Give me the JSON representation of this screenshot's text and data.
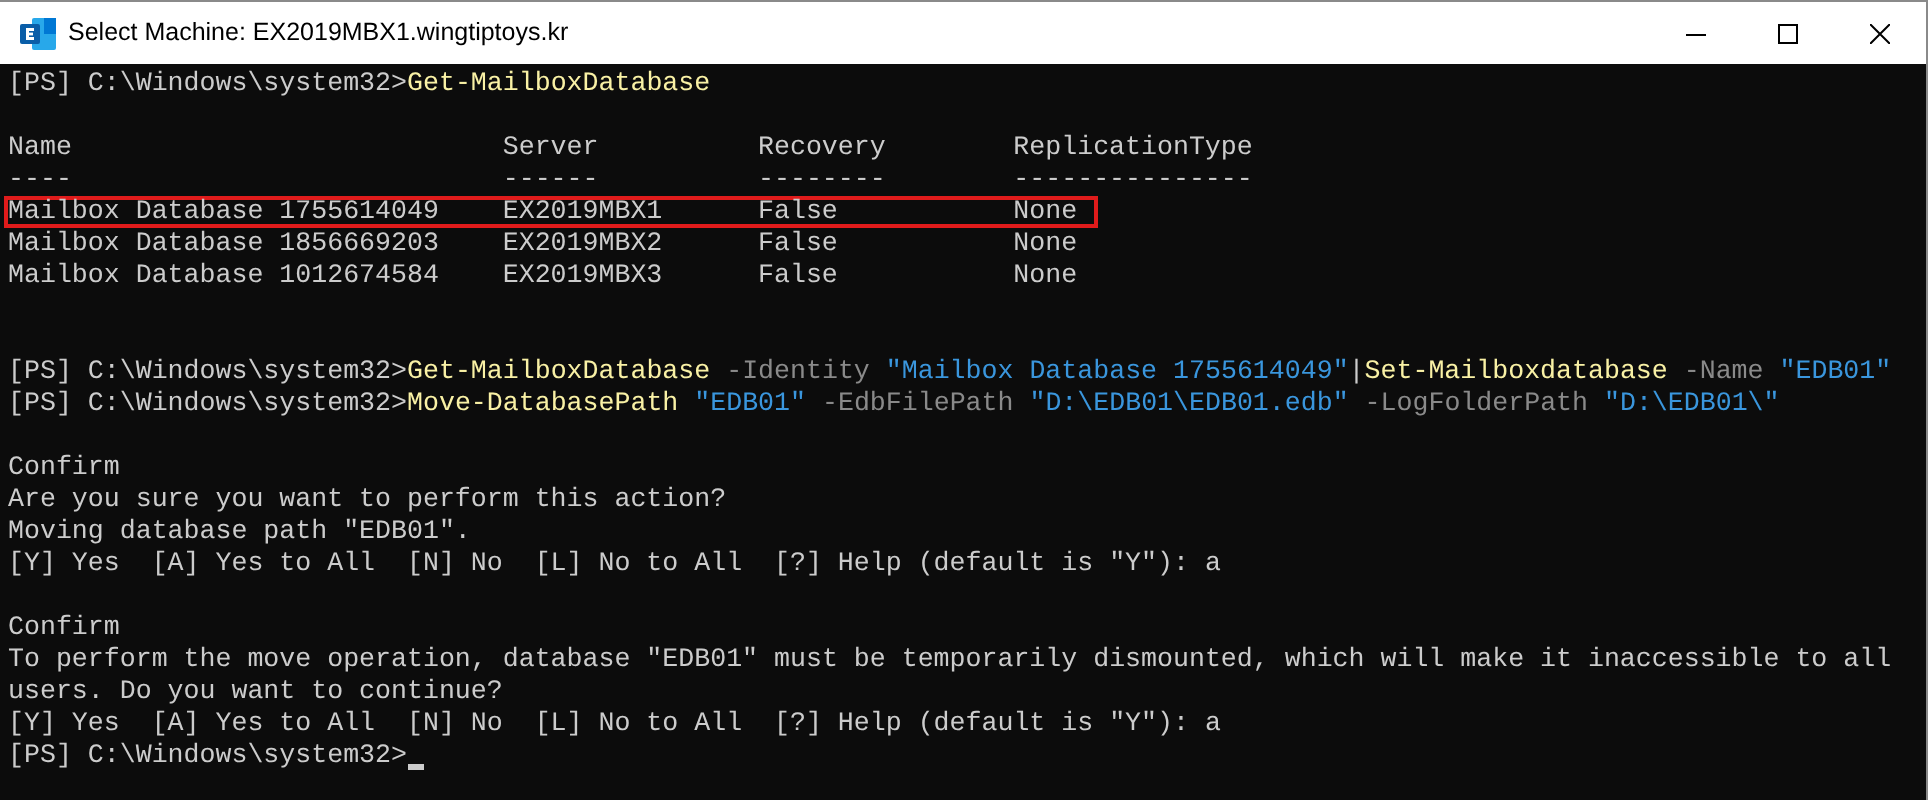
{
  "window": {
    "title": "Select Machine: EX2019MBX1.wingtiptoys.kr"
  },
  "console": [
    {
      "kind": "line",
      "segments": [
        {
          "kind": "prompt",
          "text": "[PS] C:\\Windows\\system32>"
        },
        {
          "kind": "command",
          "text": "Get-MailboxDatabase"
        }
      ]
    },
    {
      "kind": "blank"
    },
    {
      "kind": "table",
      "columns": [
        {
          "header": "Name",
          "rule": "----"
        },
        {
          "header": "Server",
          "rule": "------"
        },
        {
          "header": "Recovery",
          "rule": "--------"
        },
        {
          "header": "ReplicationType",
          "rule": "---------------"
        }
      ],
      "rows": [
        {
          "highlighted": true,
          "cells": [
            "Mailbox Database 1755614049",
            "EX2019MBX1",
            "False",
            "None"
          ]
        },
        {
          "highlighted": false,
          "cells": [
            "Mailbox Database 1856669203",
            "EX2019MBX2",
            "False",
            "None"
          ]
        },
        {
          "highlighted": false,
          "cells": [
            "Mailbox Database 1012674584",
            "EX2019MBX3",
            "False",
            "None"
          ]
        }
      ]
    },
    {
      "kind": "blank"
    },
    {
      "kind": "blank"
    },
    {
      "kind": "line",
      "segments": [
        {
          "kind": "prompt",
          "text": "[PS] C:\\Windows\\system32>"
        },
        {
          "kind": "command",
          "text": "Get-MailboxDatabase"
        },
        {
          "kind": "param",
          "text": " -Identity "
        },
        {
          "kind": "string",
          "text": "\"Mailbox Database 1755614049\""
        },
        {
          "kind": "prompt",
          "text": "|"
        },
        {
          "kind": "command",
          "text": "Set-Mailboxdatabase"
        },
        {
          "kind": "param",
          "text": " -Name "
        },
        {
          "kind": "string",
          "text": "\"EDB01\""
        }
      ]
    },
    {
      "kind": "line",
      "segments": [
        {
          "kind": "prompt",
          "text": "[PS] C:\\Windows\\system32>"
        },
        {
          "kind": "command",
          "text": "Move-DatabasePath"
        },
        {
          "kind": "string",
          "text": " \"EDB01\""
        },
        {
          "kind": "param",
          "text": " -EdbFilePath "
        },
        {
          "kind": "string",
          "text": "\"D:\\EDB01\\EDB01.edb\""
        },
        {
          "kind": "param",
          "text": " -LogFolderPath "
        },
        {
          "kind": "string",
          "text": "\"D:\\EDB01\\\""
        }
      ]
    },
    {
      "kind": "blank"
    },
    {
      "kind": "line",
      "segments": [
        {
          "kind": "output",
          "text": "Confirm"
        }
      ]
    },
    {
      "kind": "line",
      "segments": [
        {
          "kind": "output",
          "text": "Are you sure you want to perform this action?"
        }
      ]
    },
    {
      "kind": "line",
      "segments": [
        {
          "kind": "output",
          "text": "Moving database path \"EDB01\"."
        }
      ]
    },
    {
      "kind": "line",
      "segments": [
        {
          "kind": "output",
          "text": "[Y] Yes  [A] Yes to All  [N] No  [L] No to All  [?] Help (default is \"Y\"): a"
        }
      ]
    },
    {
      "kind": "blank"
    },
    {
      "kind": "line",
      "segments": [
        {
          "kind": "output",
          "text": "Confirm"
        }
      ]
    },
    {
      "kind": "line",
      "segments": [
        {
          "kind": "output",
          "text": "To perform the move operation, database \"EDB01\" must be temporarily dismounted, which will make it inaccessible to all"
        }
      ]
    },
    {
      "kind": "line",
      "segments": [
        {
          "kind": "output",
          "text": "users. Do you want to continue?"
        }
      ]
    },
    {
      "kind": "line",
      "segments": [
        {
          "kind": "output",
          "text": "[Y] Yes  [A] Yes to All  [N] No  [L] No to All  [?] Help (default is \"Y\"): a"
        }
      ]
    },
    {
      "kind": "line",
      "cursor": true,
      "segments": [
        {
          "kind": "prompt",
          "text": "[PS] C:\\Windows\\system32>"
        }
      ]
    }
  ]
}
